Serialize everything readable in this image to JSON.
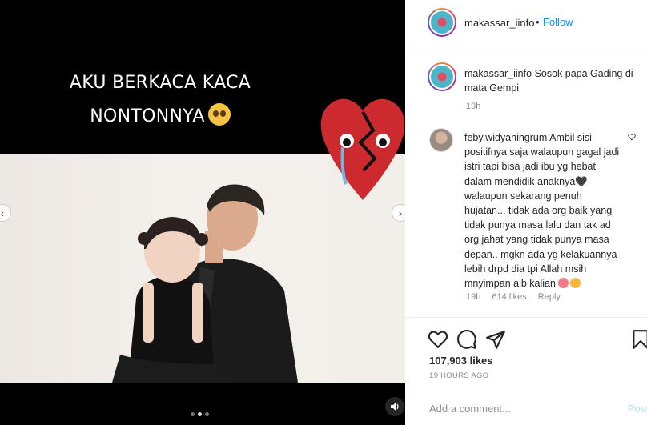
{
  "post": {
    "overlay_line1": "AKU BERKACA KACA",
    "overlay_line2": "NONTONNYA",
    "carousel": {
      "dots": 3,
      "active_index": 1
    }
  },
  "header": {
    "username": "makassar_iinfo",
    "separator": "•",
    "follow_label": "Follow"
  },
  "caption": {
    "username": "makassar_iinfo",
    "text": "Sosok papa Gading di mata Gempi",
    "time": "19h"
  },
  "comment": {
    "username": "feby.widyaningrum",
    "text": "Ambil sisi positifnya saja walaupun gagal jadi istri tapi bisa jadi ibu yg hebat dalam mendidik anaknya🖤 walaupun sekarang penuh hujatan... tidak ada org baik yang tidak punya masa lalu dan tak ad org jahat yang tidak punya masa depan.. mgkn ada yg kelakuannya lebih drpd dia tpi Allah msih mnyimpan aib kalian",
    "time": "19h",
    "likes": "614 likes",
    "reply_label": "Reply"
  },
  "actions": {
    "likes": "107,903 likes",
    "posted_ago": "19 HOURS AGO"
  },
  "add_comment": {
    "placeholder": "Add a comment...",
    "post_label": "Post"
  },
  "icons": [
    "heart-icon",
    "comment-icon",
    "share-icon",
    "bookmark-icon",
    "audio-icon",
    "chevron-left-icon",
    "chevron-right-icon"
  ]
}
